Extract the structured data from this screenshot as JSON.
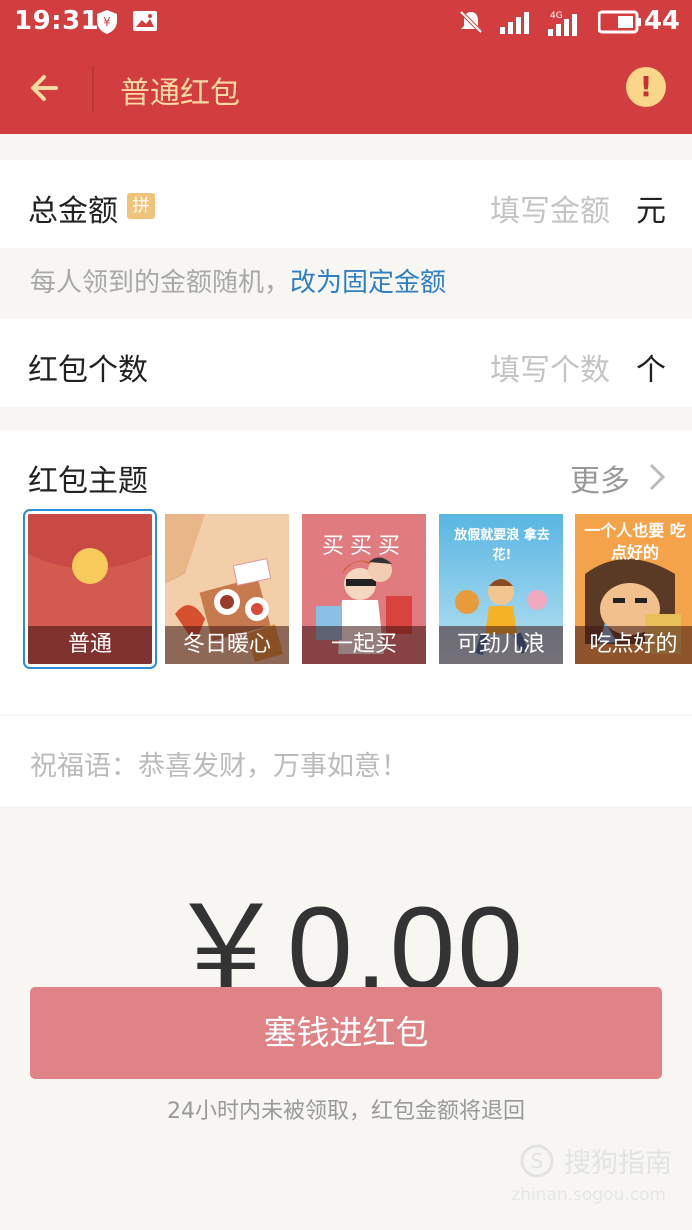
{
  "status_bar": {
    "time": "19:31",
    "battery": "44",
    "network": "4G"
  },
  "nav": {
    "title": "普通红包"
  },
  "total_amount": {
    "label": "总金额",
    "pin_badge": "拼",
    "placeholder": "填写金额",
    "unit": "元"
  },
  "random_tip": {
    "text": "每人领到的金额随机，",
    "link": "改为固定金额"
  },
  "count": {
    "label": "红包个数",
    "placeholder": "填写个数",
    "unit": "个"
  },
  "theme": {
    "title": "红包主题",
    "more": "更多",
    "cards": [
      {
        "label": "普通",
        "selected": true
      },
      {
        "label": "冬日暖心",
        "selected": false
      },
      {
        "label": "一起买",
        "selected": false,
        "art_text": "买买买"
      },
      {
        "label": "可劲儿浪",
        "selected": false,
        "art_text": "放假就要浪 拿去花!"
      },
      {
        "label": "吃点好的",
        "selected": false,
        "art_text": "一个人也要 吃点好的"
      }
    ]
  },
  "blessing": {
    "placeholder": "祝福语：恭喜发财，万事如意！"
  },
  "amount_display": "￥0.00",
  "submit_label": "塞钱进红包",
  "refund_note": "24小时内未被领取，红包金额将退回",
  "watermark": {
    "main": "搜狗指南",
    "sub": "zhinan.sogou.com"
  },
  "colors": {
    "brand_red": "#d23d3f",
    "title_gold": "#fbd9a4",
    "link_blue": "#2f7fc1",
    "button_pink": "#df8386"
  }
}
